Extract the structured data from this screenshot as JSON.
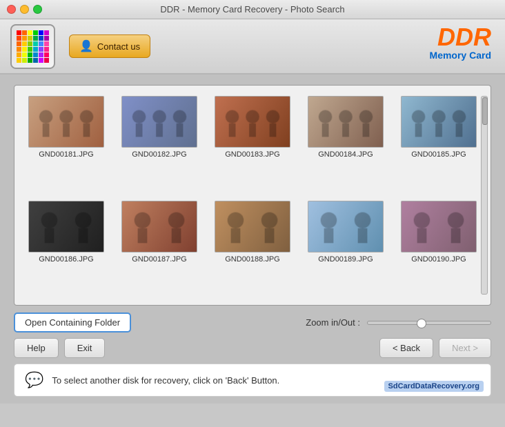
{
  "window": {
    "title": "DDR - Memory Card Recovery - Photo Search"
  },
  "header": {
    "contact_label": "Contact us",
    "brand_title": "DDR",
    "brand_subtitle": "Memory Card"
  },
  "photos": [
    {
      "filename": "GND00181.JPG",
      "color_class": "photo-1"
    },
    {
      "filename": "GND00182.JPG",
      "color_class": "photo-2"
    },
    {
      "filename": "GND00183.JPG",
      "color_class": "photo-3"
    },
    {
      "filename": "GND00184.JPG",
      "color_class": "photo-4"
    },
    {
      "filename": "GND00185.JPG",
      "color_class": "photo-5"
    },
    {
      "filename": "GND00186.JPG",
      "color_class": "photo-6"
    },
    {
      "filename": "GND00187.JPG",
      "color_class": "photo-7"
    },
    {
      "filename": "GND00188.JPG",
      "color_class": "photo-8"
    },
    {
      "filename": "GND00189.JPG",
      "color_class": "photo-9"
    },
    {
      "filename": "GND00190.JPG",
      "color_class": "photo-10"
    }
  ],
  "controls": {
    "open_folder_label": "Open Containing Folder",
    "zoom_label": "Zoom in/Out :"
  },
  "buttons": {
    "help": "Help",
    "exit": "Exit",
    "back": "< Back",
    "next": "Next >"
  },
  "status": {
    "message": "To select another disk for recovery, click on 'Back' Button."
  },
  "watermark": {
    "text": "SdCardDataRecovery.org"
  },
  "logo_colors": [
    "#ff0000",
    "#ff6600",
    "#ffff00",
    "#00cc00",
    "#0000ff",
    "#cc00cc",
    "#ff4400",
    "#ff9900",
    "#cccc00",
    "#00aa44",
    "#0044cc",
    "#aa00aa",
    "#ff6600",
    "#ffcc00",
    "#88cc00",
    "#00ccaa",
    "#4488ff",
    "#ff44aa",
    "#ff8800",
    "#ffee00",
    "#44cc00",
    "#00aacc",
    "#8844ff",
    "#ff2288",
    "#ffaa00",
    "#eeff00",
    "#00bb00",
    "#0088cc",
    "#aa22ff",
    "#ff0066",
    "#ffcc00",
    "#ccee00",
    "#00aa00",
    "#0066aa",
    "#cc00ff",
    "#ee0044"
  ]
}
